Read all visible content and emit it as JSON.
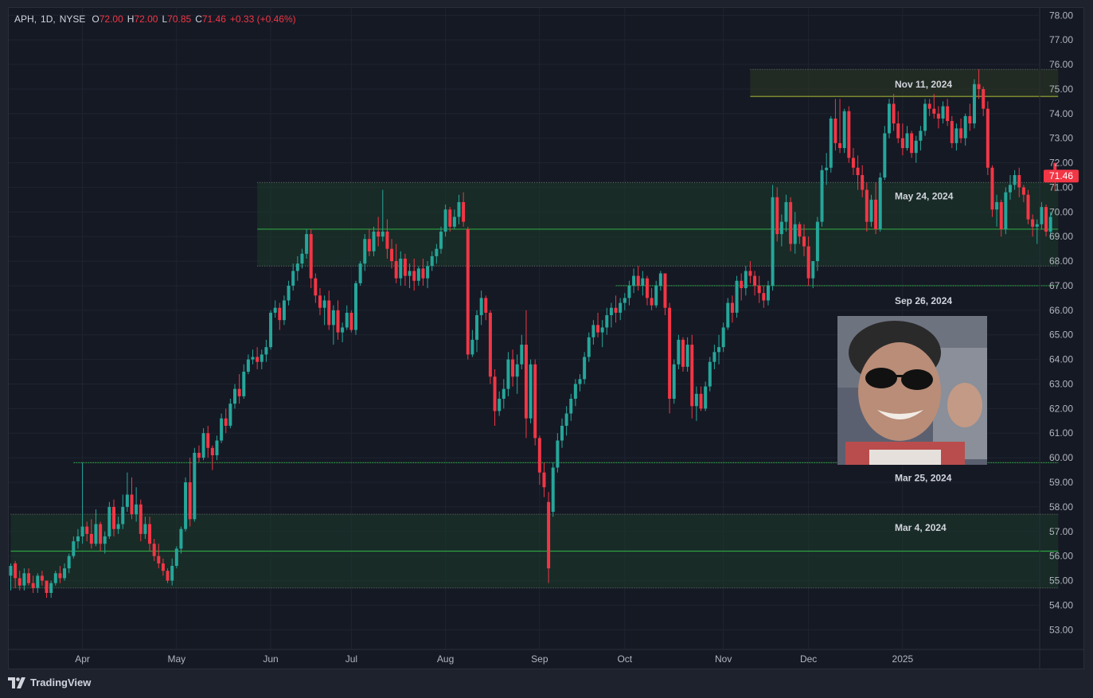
{
  "legend": {
    "symbol": "APH",
    "interval": "1D",
    "exchange": "NYSE",
    "open_key": "O",
    "open": "72.00",
    "high_key": "H",
    "high": "72.00",
    "low_key": "L",
    "low": "70.85",
    "close_key": "C",
    "close": "71.46",
    "change": "+0.33 (+0.46%)"
  },
  "brand": {
    "name": "TradingView"
  },
  "colors": {
    "up": "#26a69a",
    "down": "#f23645",
    "zone_fill": "#1b3b2a",
    "zone_fill_top": "#2e3a22",
    "level_line": "#2ea043",
    "level_line_top": "#9aa832",
    "grid": "#1f2430",
    "axis_text": "#b2b5be"
  },
  "chart_data": {
    "type": "candlestick",
    "symbol": "APH",
    "y_ticks": [
      "53.00",
      "54.00",
      "55.00",
      "56.00",
      "57.00",
      "58.00",
      "59.00",
      "60.00",
      "61.00",
      "62.00",
      "63.00",
      "64.00",
      "65.00",
      "66.00",
      "67.00",
      "68.00",
      "69.00",
      "70.00",
      "71.00",
      "72.00",
      "73.00",
      "74.00",
      "75.00",
      "76.00",
      "77.00",
      "78.00"
    ],
    "ylim": [
      52.2,
      78.3
    ],
    "x_ticks": [
      {
        "label": "Apr",
        "index": 16
      },
      {
        "label": "May",
        "index": 37
      },
      {
        "label": "Jun",
        "index": 58
      },
      {
        "label": "Jul",
        "index": 76
      },
      {
        "label": "Aug",
        "index": 97
      },
      {
        "label": "Sep",
        "index": 118
      },
      {
        "label": "Oct",
        "index": 137
      },
      {
        "label": "Nov",
        "index": 159
      },
      {
        "label": "Dec",
        "index": 178
      },
      {
        "label": "2025",
        "index": 199
      }
    ],
    "last_price_label": "71.46",
    "last_price": 71.46,
    "zones": [
      {
        "from_index": 0,
        "low": 54.7,
        "high": 57.7,
        "mid": 56.2,
        "label": "Mar 4, 2024",
        "style": "green"
      },
      {
        "from_index": 55,
        "low": 67.8,
        "high": 71.2,
        "mid": 69.3,
        "label": "May 24, 2024",
        "style": "green"
      },
      {
        "from_index": 165,
        "low": 74.7,
        "high": 75.8,
        "mid": 74.7,
        "label": "Nov 11, 2024",
        "style": "olive"
      }
    ],
    "levels": [
      {
        "from_index": 14,
        "price": 59.8,
        "label": "Mar 25, 2024"
      },
      {
        "from_index": 135,
        "price": 67.0,
        "label": "Sep 26, 2024"
      }
    ],
    "candles": [
      [
        55.2,
        55.7,
        54.6,
        55.6
      ],
      [
        55.7,
        55.8,
        54.7,
        55.1
      ],
      [
        55.1,
        55.4,
        54.6,
        54.8
      ],
      [
        54.8,
        55.5,
        54.6,
        55.3
      ],
      [
        55.3,
        55.5,
        54.8,
        54.9
      ],
      [
        54.9,
        55.2,
        54.5,
        54.7
      ],
      [
        54.7,
        55.3,
        54.5,
        55.2
      ],
      [
        55.2,
        55.4,
        54.8,
        55.0
      ],
      [
        55.0,
        55.0,
        54.3,
        54.5
      ],
      [
        54.5,
        55.0,
        54.3,
        54.9
      ],
      [
        54.9,
        55.4,
        54.8,
        55.3
      ],
      [
        55.3,
        55.6,
        54.9,
        55.1
      ],
      [
        55.1,
        55.7,
        55.0,
        55.5
      ],
      [
        55.5,
        56.1,
        55.3,
        56.0
      ],
      [
        56.0,
        56.8,
        55.9,
        56.6
      ],
      [
        56.6,
        57.1,
        56.3,
        56.8
      ],
      [
        56.8,
        59.8,
        56.5,
        57.2
      ],
      [
        57.2,
        57.4,
        56.6,
        56.9
      ],
      [
        56.9,
        57.5,
        56.3,
        56.5
      ],
      [
        56.5,
        57.9,
        56.4,
        57.3
      ],
      [
        57.3,
        57.4,
        56.2,
        56.5
      ],
      [
        56.5,
        57.0,
        56.1,
        56.8
      ],
      [
        56.8,
        58.2,
        56.7,
        58.0
      ],
      [
        58.0,
        58.3,
        56.8,
        57.1
      ],
      [
        57.1,
        57.6,
        56.9,
        57.3
      ],
      [
        57.3,
        58.5,
        57.1,
        58.0
      ],
      [
        58.0,
        59.4,
        57.8,
        58.5
      ],
      [
        58.5,
        59.2,
        57.5,
        57.7
      ],
      [
        57.7,
        58.8,
        57.4,
        58.1
      ],
      [
        58.1,
        58.3,
        56.6,
        56.9
      ],
      [
        56.9,
        57.6,
        56.7,
        57.3
      ],
      [
        57.3,
        57.6,
        56.2,
        56.5
      ],
      [
        56.5,
        56.7,
        55.8,
        56.0
      ],
      [
        56.0,
        56.5,
        55.5,
        55.7
      ],
      [
        55.7,
        55.9,
        55.2,
        55.4
      ],
      [
        55.4,
        55.5,
        54.9,
        55.0
      ],
      [
        55.0,
        55.9,
        54.8,
        55.6
      ],
      [
        55.6,
        56.4,
        55.5,
        56.3
      ],
      [
        56.3,
        57.2,
        56.1,
        57.1
      ],
      [
        57.1,
        59.2,
        57.0,
        59.0
      ],
      [
        59.0,
        60.0,
        57.2,
        57.5
      ],
      [
        57.5,
        60.4,
        57.4,
        60.2
      ],
      [
        60.2,
        60.5,
        59.8,
        60.0
      ],
      [
        60.0,
        61.2,
        59.9,
        61.0
      ],
      [
        61.0,
        61.3,
        60.0,
        60.4
      ],
      [
        60.4,
        60.5,
        59.5,
        60.1
      ],
      [
        60.1,
        60.9,
        59.9,
        60.7
      ],
      [
        60.7,
        61.8,
        60.6,
        61.6
      ],
      [
        61.6,
        62.0,
        61.0,
        61.3
      ],
      [
        61.3,
        62.4,
        61.2,
        62.2
      ],
      [
        62.2,
        63.0,
        62.0,
        62.8
      ],
      [
        62.8,
        63.4,
        62.2,
        62.5
      ],
      [
        62.5,
        63.8,
        62.4,
        63.5
      ],
      [
        63.5,
        64.2,
        63.4,
        64.0
      ],
      [
        64.0,
        64.4,
        63.8,
        64.1
      ],
      [
        64.1,
        64.5,
        63.6,
        63.9
      ],
      [
        63.9,
        64.4,
        63.6,
        64.2
      ],
      [
        64.2,
        64.8,
        63.9,
        64.5
      ],
      [
        64.5,
        66.0,
        64.4,
        65.9
      ],
      [
        65.9,
        66.4,
        65.7,
        66.1
      ],
      [
        66.1,
        66.3,
        65.2,
        65.6
      ],
      [
        65.6,
        66.6,
        65.4,
        66.4
      ],
      [
        66.4,
        67.2,
        66.2,
        67.0
      ],
      [
        67.0,
        67.9,
        66.8,
        67.6
      ],
      [
        67.6,
        68.2,
        67.2,
        67.9
      ],
      [
        67.9,
        68.5,
        67.7,
        68.3
      ],
      [
        68.3,
        69.3,
        68.1,
        69.1
      ],
      [
        69.1,
        69.3,
        66.9,
        67.3
      ],
      [
        67.3,
        67.5,
        66.3,
        66.6
      ],
      [
        66.6,
        66.9,
        65.8,
        66.1
      ],
      [
        66.1,
        66.6,
        65.4,
        66.4
      ],
      [
        66.4,
        66.8,
        65.2,
        65.4
      ],
      [
        65.4,
        66.2,
        64.6,
        66.0
      ],
      [
        66.0,
        66.4,
        64.8,
        65.1
      ],
      [
        65.1,
        65.5,
        64.7,
        65.3
      ],
      [
        65.3,
        66.2,
        65.2,
        65.9
      ],
      [
        65.9,
        66.0,
        65.1,
        65.2
      ],
      [
        65.2,
        67.2,
        65.0,
        67.1
      ],
      [
        67.1,
        68.0,
        67.0,
        67.9
      ],
      [
        67.9,
        69.1,
        67.6,
        68.9
      ],
      [
        68.9,
        69.3,
        68.2,
        68.4
      ],
      [
        68.4,
        69.4,
        68.2,
        69.2
      ],
      [
        69.2,
        69.8,
        68.6,
        69.0
      ],
      [
        69.0,
        70.9,
        68.8,
        69.2
      ],
      [
        69.2,
        69.7,
        68.1,
        68.5
      ],
      [
        68.5,
        68.9,
        67.7,
        68.0
      ],
      [
        68.0,
        68.7,
        67.1,
        67.3
      ],
      [
        67.3,
        68.4,
        67.0,
        68.1
      ],
      [
        68.1,
        68.3,
        67.0,
        67.4
      ],
      [
        67.4,
        67.9,
        66.9,
        67.6
      ],
      [
        67.6,
        68.1,
        66.8,
        67.2
      ],
      [
        67.2,
        67.8,
        67.0,
        67.7
      ],
      [
        67.7,
        68.1,
        67.0,
        67.3
      ],
      [
        67.3,
        68.0,
        66.9,
        67.8
      ],
      [
        67.8,
        68.4,
        67.6,
        68.2
      ],
      [
        68.2,
        68.7,
        67.9,
        68.5
      ],
      [
        68.5,
        69.4,
        68.3,
        69.2
      ],
      [
        69.2,
        70.3,
        69.0,
        70.1
      ],
      [
        70.1,
        70.2,
        69.2,
        69.4
      ],
      [
        69.4,
        70.1,
        69.3,
        69.8
      ],
      [
        69.8,
        70.7,
        69.5,
        70.4
      ],
      [
        70.4,
        70.8,
        69.4,
        69.6
      ],
      [
        69.3,
        69.4,
        64.0,
        64.2
      ],
      [
        64.2,
        65.2,
        64.1,
        64.8
      ],
      [
        64.8,
        66.0,
        64.3,
        65.8
      ],
      [
        65.8,
        66.8,
        65.4,
        66.5
      ],
      [
        66.5,
        66.6,
        65.6,
        65.9
      ],
      [
        65.9,
        66.0,
        63.0,
        63.3
      ],
      [
        63.3,
        63.6,
        61.3,
        61.9
      ],
      [
        61.9,
        62.7,
        61.7,
        62.4
      ],
      [
        62.4,
        63.2,
        62.0,
        62.8
      ],
      [
        62.8,
        64.3,
        62.5,
        64.0
      ],
      [
        64.0,
        64.4,
        62.9,
        63.3
      ],
      [
        63.3,
        64.2,
        62.6,
        63.8
      ],
      [
        63.8,
        65.0,
        63.6,
        64.6
      ],
      [
        64.6,
        66.0,
        60.8,
        61.6
      ],
      [
        61.6,
        64.0,
        61.4,
        63.8
      ],
      [
        63.8,
        64.0,
        60.5,
        60.8
      ],
      [
        60.8,
        60.9,
        58.9,
        59.4
      ],
      [
        59.4,
        59.8,
        58.4,
        58.8
      ],
      [
        58.2,
        58.6,
        54.9,
        55.5
      ],
      [
        57.8,
        59.8,
        57.6,
        59.6
      ],
      [
        59.6,
        61.0,
        59.4,
        60.7
      ],
      [
        60.7,
        61.6,
        60.4,
        61.3
      ],
      [
        61.3,
        62.1,
        60.9,
        61.8
      ],
      [
        61.8,
        62.6,
        61.5,
        62.4
      ],
      [
        62.4,
        63.2,
        62.1,
        63.0
      ],
      [
        63.0,
        63.4,
        62.7,
        63.2
      ],
      [
        63.2,
        64.3,
        63.0,
        64.1
      ],
      [
        64.1,
        65.1,
        63.9,
        64.9
      ],
      [
        64.9,
        65.6,
        64.6,
        65.4
      ],
      [
        65.4,
        65.9,
        64.9,
        65.1
      ],
      [
        65.1,
        65.6,
        64.5,
        65.3
      ],
      [
        65.3,
        66.1,
        65.0,
        65.8
      ],
      [
        65.8,
        66.3,
        65.3,
        66.1
      ],
      [
        66.1,
        66.6,
        65.5,
        65.9
      ],
      [
        65.9,
        66.5,
        65.6,
        66.3
      ],
      [
        66.3,
        66.7,
        66.0,
        66.5
      ],
      [
        66.5,
        67.2,
        66.2,
        67.0
      ],
      [
        67.0,
        67.7,
        66.7,
        67.4
      ],
      [
        67.4,
        67.8,
        66.8,
        67.0
      ],
      [
        67.0,
        67.6,
        66.6,
        67.3
      ],
      [
        67.3,
        67.4,
        66.2,
        66.5
      ],
      [
        66.5,
        66.9,
        66.0,
        66.2
      ],
      [
        66.2,
        67.2,
        66.1,
        67.0
      ],
      [
        67.0,
        67.6,
        66.8,
        67.5
      ],
      [
        67.5,
        67.5,
        65.8,
        66.1
      ],
      [
        66.1,
        66.3,
        61.8,
        62.4
      ],
      [
        62.4,
        64.0,
        62.2,
        63.8
      ],
      [
        63.8,
        65.0,
        63.6,
        64.8
      ],
      [
        64.8,
        64.9,
        63.5,
        63.7
      ],
      [
        63.7,
        64.9,
        63.5,
        64.6
      ],
      [
        64.6,
        65.0,
        61.6,
        62.1
      ],
      [
        62.1,
        62.9,
        61.5,
        62.6
      ],
      [
        62.6,
        62.9,
        61.9,
        62.0
      ],
      [
        62.0,
        63.1,
        61.9,
        62.9
      ],
      [
        62.9,
        64.1,
        62.7,
        63.9
      ],
      [
        63.9,
        64.6,
        63.6,
        64.3
      ],
      [
        64.3,
        65.0,
        63.8,
        64.5
      ],
      [
        64.5,
        65.5,
        64.3,
        65.3
      ],
      [
        65.3,
        66.5,
        65.2,
        66.3
      ],
      [
        66.3,
        66.6,
        65.5,
        65.9
      ],
      [
        65.9,
        67.4,
        65.7,
        67.2
      ],
      [
        67.2,
        67.5,
        66.4,
        66.9
      ],
      [
        66.9,
        67.8,
        66.6,
        67.6
      ],
      [
        67.6,
        68.0,
        67.1,
        67.4
      ],
      [
        67.4,
        67.6,
        66.6,
        67.0
      ],
      [
        67.0,
        67.4,
        66.3,
        66.7
      ],
      [
        66.7,
        67.0,
        66.1,
        66.4
      ],
      [
        66.4,
        67.2,
        66.2,
        67.0
      ],
      [
        67.0,
        71.1,
        66.8,
        70.6
      ],
      [
        70.6,
        71.0,
        68.8,
        69.1
      ],
      [
        69.1,
        69.9,
        68.6,
        69.6
      ],
      [
        69.6,
        70.7,
        69.2,
        70.4
      ],
      [
        70.4,
        70.6,
        68.4,
        68.7
      ],
      [
        68.7,
        70.0,
        68.3,
        69.5
      ],
      [
        69.5,
        69.6,
        68.7,
        69.0
      ],
      [
        69.0,
        69.5,
        68.2,
        68.6
      ],
      [
        68.6,
        69.0,
        67.0,
        67.3
      ],
      [
        67.3,
        68.0,
        66.9,
        68.0
      ],
      [
        68.0,
        69.8,
        67.6,
        69.6
      ],
      [
        69.6,
        71.9,
        69.4,
        71.7
      ],
      [
        71.7,
        72.4,
        71.1,
        71.8
      ],
      [
        71.8,
        73.9,
        71.6,
        73.8
      ],
      [
        73.8,
        74.6,
        72.5,
        72.8
      ],
      [
        72.8,
        74.6,
        72.4,
        72.6
      ],
      [
        72.6,
        74.2,
        72.4,
        74.1
      ],
      [
        74.1,
        74.3,
        72.0,
        72.2
      ],
      [
        72.2,
        72.6,
        71.5,
        71.8
      ],
      [
        71.8,
        72.3,
        70.9,
        71.5
      ],
      [
        71.5,
        71.9,
        70.6,
        70.9
      ],
      [
        70.9,
        71.2,
        69.2,
        69.6
      ],
      [
        69.6,
        70.7,
        69.4,
        70.5
      ],
      [
        70.5,
        71.2,
        69.1,
        69.3
      ],
      [
        69.3,
        71.6,
        69.2,
        71.4
      ],
      [
        71.4,
        73.5,
        71.3,
        73.2
      ],
      [
        73.2,
        74.6,
        73.0,
        74.4
      ],
      [
        74.4,
        74.8,
        73.3,
        73.6
      ],
      [
        73.6,
        74.1,
        72.8,
        73.0
      ],
      [
        73.0,
        73.6,
        72.3,
        72.6
      ],
      [
        72.6,
        73.5,
        72.5,
        73.2
      ],
      [
        73.2,
        73.3,
        72.2,
        72.4
      ],
      [
        72.4,
        73.1,
        72.0,
        72.9
      ],
      [
        72.9,
        73.5,
        72.5,
        73.3
      ],
      [
        73.3,
        74.6,
        73.1,
        74.4
      ],
      [
        74.4,
        74.6,
        73.9,
        74.2
      ],
      [
        74.2,
        74.8,
        73.8,
        74.0
      ],
      [
        74.0,
        74.3,
        73.4,
        73.8
      ],
      [
        73.8,
        74.5,
        73.6,
        74.3
      ],
      [
        74.3,
        74.6,
        73.5,
        73.7
      ],
      [
        73.7,
        73.9,
        72.6,
        72.8
      ],
      [
        72.8,
        73.6,
        72.5,
        73.4
      ],
      [
        73.4,
        73.8,
        72.8,
        73.0
      ],
      [
        73.0,
        74.0,
        72.7,
        73.9
      ],
      [
        73.9,
        74.4,
        73.3,
        73.6
      ],
      [
        73.6,
        75.4,
        73.4,
        75.2
      ],
      [
        75.2,
        75.8,
        74.6,
        75.0
      ],
      [
        75.0,
        75.1,
        73.9,
        74.2
      ],
      [
        74.2,
        74.5,
        71.5,
        71.8
      ],
      [
        71.8,
        71.9,
        69.8,
        70.1
      ],
      [
        70.1,
        70.7,
        69.4,
        70.4
      ],
      [
        70.4,
        70.5,
        69.0,
        69.3
      ],
      [
        69.3,
        71.0,
        69.1,
        70.8
      ],
      [
        70.8,
        71.5,
        70.5,
        71.1
      ],
      [
        71.1,
        71.7,
        70.9,
        71.5
      ],
      [
        71.5,
        71.8,
        70.6,
        71.0
      ],
      [
        71.0,
        71.1,
        70.4,
        70.7
      ],
      [
        70.7,
        70.9,
        69.5,
        69.7
      ],
      [
        69.7,
        69.9,
        69.0,
        69.4
      ],
      [
        69.4,
        69.7,
        68.7,
        69.5
      ],
      [
        69.5,
        70.4,
        69.3,
        70.2
      ],
      [
        70.2,
        70.3,
        69.0,
        69.2
      ],
      [
        69.2,
        70.0,
        68.9,
        69.8
      ],
      [
        72.0,
        72.0,
        70.85,
        71.46
      ]
    ]
  }
}
